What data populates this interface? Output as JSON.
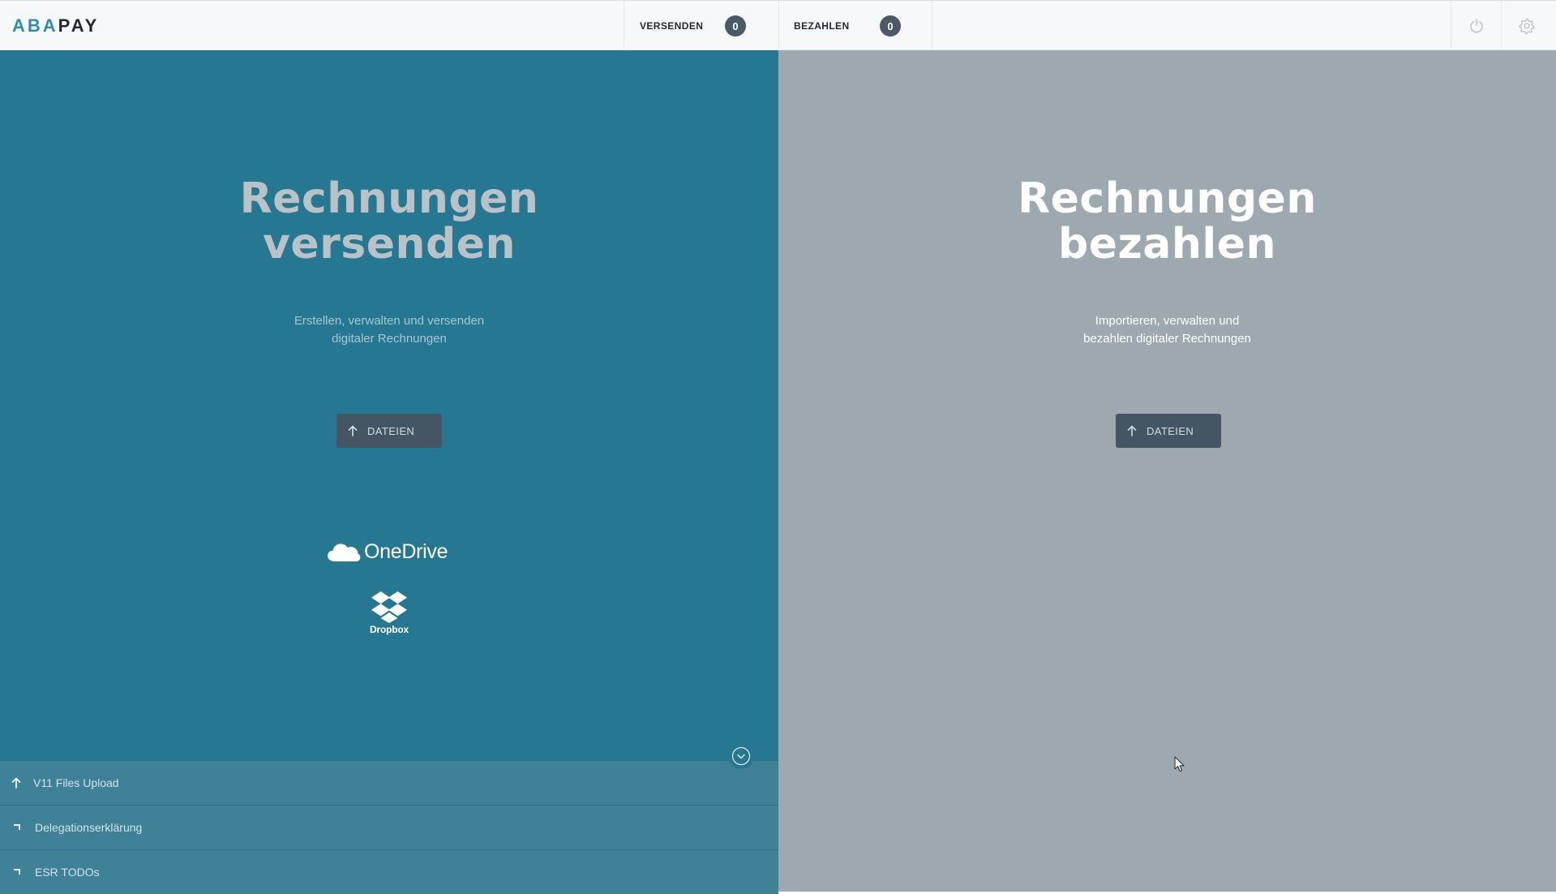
{
  "app": {
    "logo_part_a": "ABA",
    "logo_part_b": "PAY"
  },
  "header": {
    "tabs": [
      {
        "label": "VERSENDEN",
        "count": "0"
      },
      {
        "label": "BEZAHLEN",
        "count": "0"
      }
    ],
    "icons": [
      "power-icon",
      "gear-icon"
    ]
  },
  "send_panel": {
    "title_line1": "Rechnungen",
    "title_line2": "versenden",
    "description_line1": "Erstellen, verwalten und versenden",
    "description_line2": "digitaler Rechnungen",
    "upload_label": "DATEIEN",
    "cloud_onedrive": "OneDrive",
    "cloud_dropbox": "Dropbox",
    "bg_color": "#267892"
  },
  "pay_panel": {
    "title_line1": "Rechnungen",
    "title_line2": "bezahlen",
    "description_line1": "Importieren, verwalten und",
    "description_line2": "bezahlen digitaler Rechnungen",
    "upload_label": "DATEIEN",
    "bg_color": "#9da9ae"
  },
  "bottom_list": {
    "items": [
      {
        "label": "V11 Files Upload",
        "icon": "upload-arrow-icon"
      },
      {
        "label": "Delegationserklärung",
        "icon": "corner-icon"
      },
      {
        "label": "ESR TODOs",
        "icon": "corner-icon"
      }
    ]
  }
}
